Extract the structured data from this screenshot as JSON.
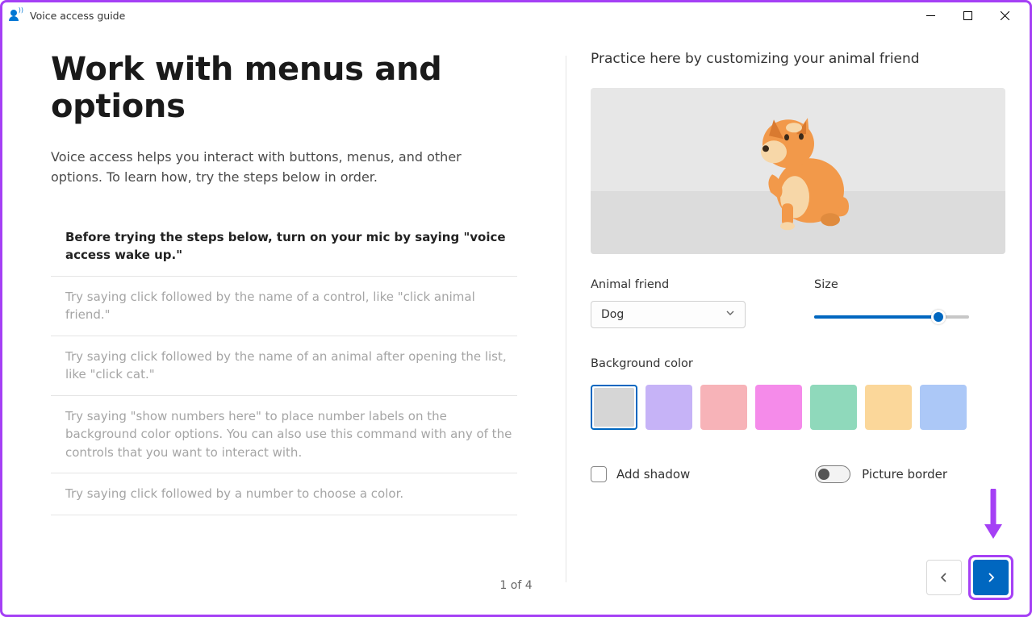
{
  "window": {
    "title": "Voice access guide"
  },
  "main": {
    "heading": "Work with menus and options",
    "subheading": "Voice access helps you interact with buttons, menus, and other options. To learn how, try the steps below in order.",
    "steps": [
      "Before trying the steps below, turn on your mic by saying \"voice access wake up.\"",
      "Try saying click followed by the name of a control, like \"click animal friend.\"",
      "Try saying click followed by the name of an animal after opening the list, like \"click cat.\"",
      "Try saying \"show numbers here\" to place number labels on the background color options. You can also use this command with any of the controls that you want to interact with.",
      "Try saying click followed by a number to choose a color."
    ],
    "page_indicator": "1 of 4"
  },
  "practice": {
    "title": "Practice here by customizing your animal friend",
    "animal_label": "Animal friend",
    "animal_value": "Dog",
    "size_label": "Size",
    "size_value": 80,
    "bg_label": "Background color",
    "colors": [
      "#d6d6d6",
      "#c6b3f7",
      "#f7b3b8",
      "#f58bea",
      "#8fd9bb",
      "#fbd79a",
      "#acc8f7"
    ],
    "selected_color_index": 0,
    "add_shadow_label": "Add shadow",
    "add_shadow_checked": false,
    "picture_border_label": "Picture border",
    "picture_border_on": false
  }
}
